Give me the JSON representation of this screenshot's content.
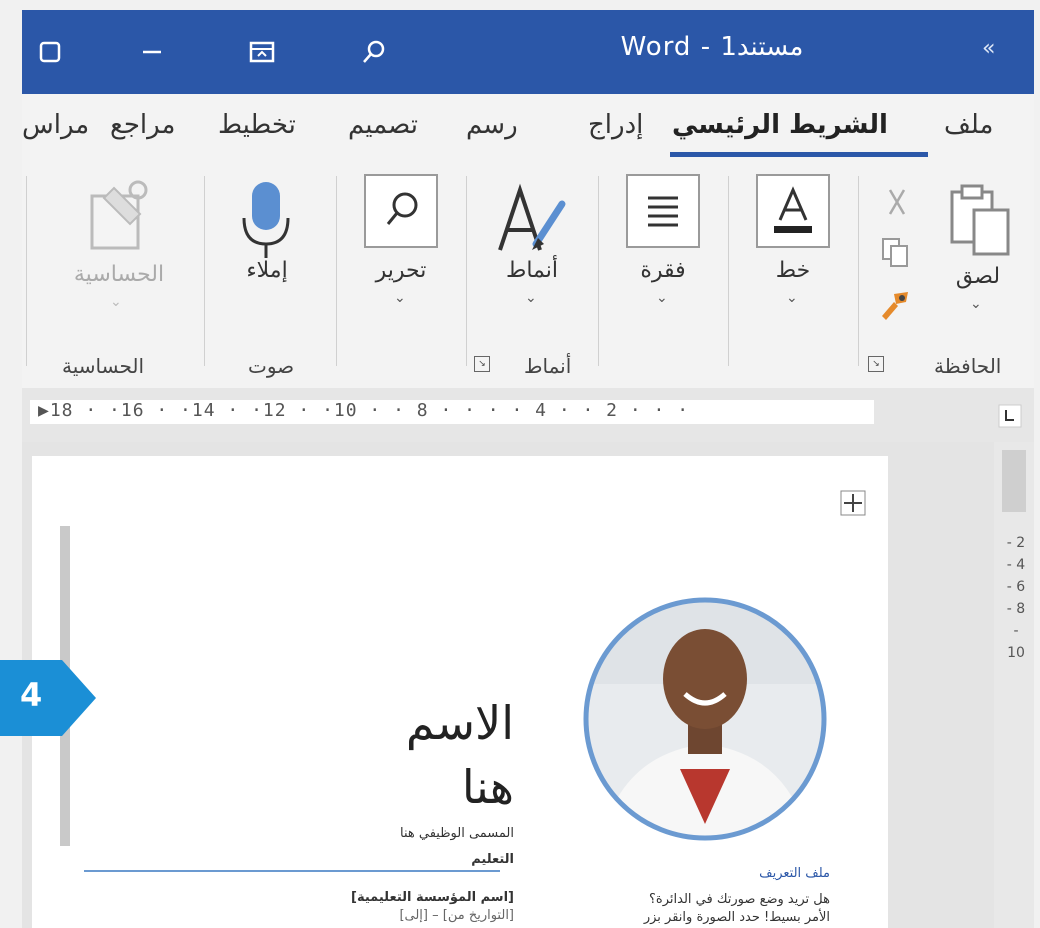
{
  "titlebar": {
    "title": "Word  -  مستند1",
    "chevron": "«",
    "icons": [
      "restore-icon",
      "minimize-icon",
      "ribbon-display-icon",
      "search-icon"
    ]
  },
  "tabs": [
    {
      "label": "ملف",
      "active": false
    },
    {
      "label": "الشريط الرئيسي",
      "active": true
    },
    {
      "label": "إدراج",
      "active": false
    },
    {
      "label": "رسم",
      "active": false
    },
    {
      "label": "تصميم",
      "active": false
    },
    {
      "label": "تخطيط",
      "active": false
    },
    {
      "label": "مراجع",
      "active": false
    },
    {
      "label": "مراس",
      "active": false
    }
  ],
  "ribbon": {
    "paste_label": "لصق",
    "font_label": "خط",
    "paragraph_label": "فقرة",
    "styles_label": "أنماط",
    "editing_label": "تحرير",
    "dictate_label": "إملاء",
    "sensitivity_label": "الحساسية",
    "groups": {
      "clipboard": "الحافظة",
      "styles": "أنماط",
      "voice": "صوت",
      "sensitivity": "الحساسية"
    }
  },
  "ruler": {
    "text": "▶18 · ·16 · ·14 · ·12 · ·10 · · 8 ·   · · · 4 · · 2 · · ·"
  },
  "vertical_ruler": "- 2 - 4 - 6 - 8 - 10",
  "document": {
    "name_line1": "الاسم",
    "name_line2": "هنا",
    "job_title": "المسمى الوظيفي هنا",
    "education_heading": "التعليم",
    "institution": "[اسم المؤسسة التعليمية]",
    "dates": "[التواريخ من] – [إلى]",
    "profile_heading": "ملف التعريف",
    "profile_text_1": "هل تريد وضع صورتك في الدائرة؟",
    "profile_text_2": "الأمر بسيط! حدد الصورة وانقر بزر"
  },
  "badge": {
    "number": "4",
    "color": "#1b8fd6"
  },
  "colors": {
    "titlebar": "#2b57a8",
    "accent": "#2b57a8"
  }
}
